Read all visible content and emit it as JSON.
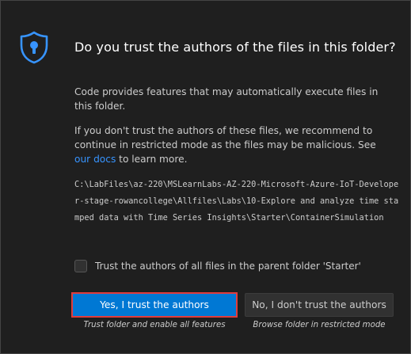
{
  "dialog": {
    "title": "Do you trust the authors of the files in this folder?",
    "paragraph1": "Code provides features that may automatically execute files in this folder.",
    "paragraph2_text": "If you don't trust the authors of these files, we recommend to continue in restricted mode as the files may be malicious. See ",
    "paragraph2_link": "our docs",
    "paragraph2_tail": " to learn more.",
    "folder_path": "C:\\LabFiles\\az-220\\MSLearnLabs-AZ-220-Microsoft-Azure-IoT-Developer-stage-rowancollege\\Allfiles\\Labs\\10-Explore and analyze time stamped data with Time Series Insights\\Starter\\ContainerSimulation",
    "checkbox_label": "Trust the authors of all files in the parent folder 'Starter'",
    "trust_button": "Yes, I trust the authors",
    "trust_caption": "Trust folder and enable all features",
    "no_trust_button": "No, I don't trust the authors",
    "no_trust_caption": "Browse folder in restricted mode"
  },
  "colors": {
    "background": "#1f1f1f",
    "accent": "#0078d4",
    "link": "#3794ff",
    "focus_outline": "#e03c3c"
  },
  "icons": {
    "shield": "shield-lock-icon"
  }
}
